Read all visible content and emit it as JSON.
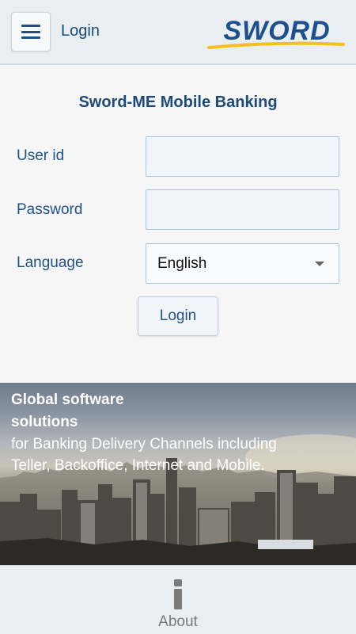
{
  "header": {
    "title": "Login",
    "menu_icon": "hamburger-menu-icon",
    "logo_text": "SWORD",
    "colors": {
      "background": "#e9eef3",
      "accent": "#1d4a78",
      "logo_underline": "#f2c21a"
    }
  },
  "login_form": {
    "title": "Sword-ME Mobile Banking",
    "user_id_label": "User id",
    "user_id_value": "",
    "password_label": "Password",
    "password_value": "",
    "language_label": "Language",
    "language_selected": "English",
    "login_button": "Login"
  },
  "banner": {
    "heading_line1": "Global software",
    "heading_line2": "solutions",
    "subtext_line1": "for Banking Delivery Channels including",
    "subtext_line2": "Teller, Backoffice, Internet and Mobile."
  },
  "footer": {
    "about_label": "About",
    "about_icon": "info-icon"
  }
}
